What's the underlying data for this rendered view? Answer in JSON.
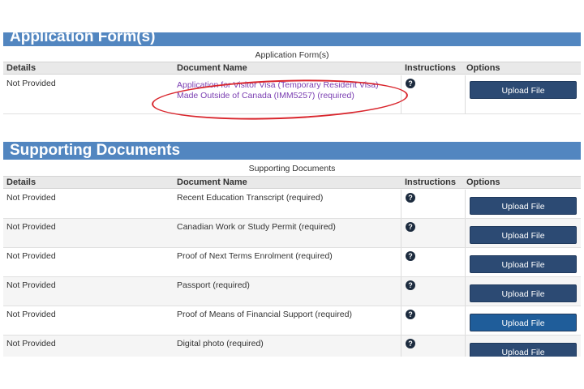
{
  "application_section": {
    "title": "Application Form(s)",
    "caption": "Application Form(s)",
    "columns": {
      "details": "Details",
      "document_name": "Document Name",
      "instructions": "Instructions",
      "options": "Options"
    },
    "row": {
      "details": "Not Provided",
      "document_name": "Application for Visitor Visa (Temporary Resident Visa) Made Outside of Canada (IMM5257)",
      "required": "(required)",
      "help_icon": "?",
      "button": "Upload File"
    }
  },
  "supporting_section": {
    "title": "Supporting Documents",
    "caption": "Supporting Documents",
    "columns": {
      "details": "Details",
      "document_name": "Document Name",
      "instructions": "Instructions",
      "options": "Options"
    },
    "rows": [
      {
        "details": "Not Provided",
        "document_name": "Recent Education Transcript  (required)",
        "help_icon": "?",
        "button": "Upload File"
      },
      {
        "details": "Not Provided",
        "document_name": "Canadian Work or Study Permit  (required)",
        "help_icon": "?",
        "button": "Upload File"
      },
      {
        "details": "Not Provided",
        "document_name": "Proof of Next Terms Enrolment  (required)",
        "help_icon": "?",
        "button": "Upload File"
      },
      {
        "details": "Not Provided",
        "document_name": "Passport  (required)",
        "help_icon": "?",
        "button": "Upload File"
      },
      {
        "details": "Not Provided",
        "document_name": "Proof of Means of Financial Support  (required)",
        "help_icon": "?",
        "button": "Upload File"
      },
      {
        "details": "Not Provided",
        "document_name": "Digital photo  (required)",
        "help_icon": "?",
        "button": "Upload File"
      }
    ]
  },
  "colors": {
    "header_bar": "#5286c0",
    "button": "#2c4a73",
    "button_hover": "#1f5d9a",
    "link": "#7b3fb2",
    "annotation": "#d9262d"
  }
}
